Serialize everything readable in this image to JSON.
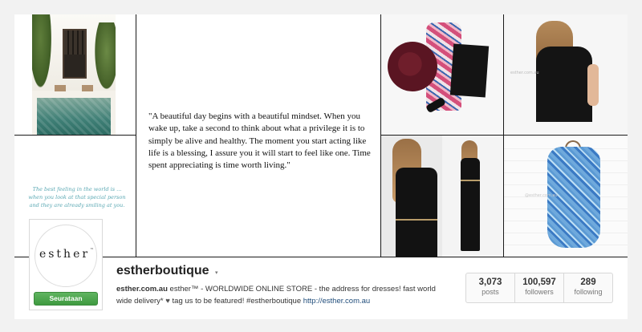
{
  "collage": {
    "small_quote": "The best feeling in the world is ... when you look at that special person and they are already smiling at you.",
    "big_quote": "\"A beautiful day begins with a beautiful mindset. When you wake up, take a second to think about what a privilege it is to simply be alive and healthy. The moment you start acting like life is a blessing, I assure you it will start to feel like one. Time spent appreciating is time worth living.\"",
    "lace_caption": "esther.com.au",
    "playsuit_watermark": "@esther.com.au"
  },
  "profile": {
    "avatar_text": "esther",
    "avatar_tm": "™",
    "follow_label": "Seurataan",
    "username": "estherboutique",
    "caret": "▾",
    "bio_site": "esther.com.au",
    "bio_text": " esther™ - WORLDWIDE ONLINE STORE - the address for dresses! fast world wide delivery*",
    "bio_heart": "♥",
    "bio_text2": " tag us to be featured! #estherboutique ",
    "bio_link": "http://esther.com.au",
    "accent": "#4aa44b"
  },
  "stats": [
    {
      "num": "3,073",
      "label": "posts"
    },
    {
      "num": "100,597",
      "label": "followers"
    },
    {
      "num": "289",
      "label": "following"
    }
  ]
}
